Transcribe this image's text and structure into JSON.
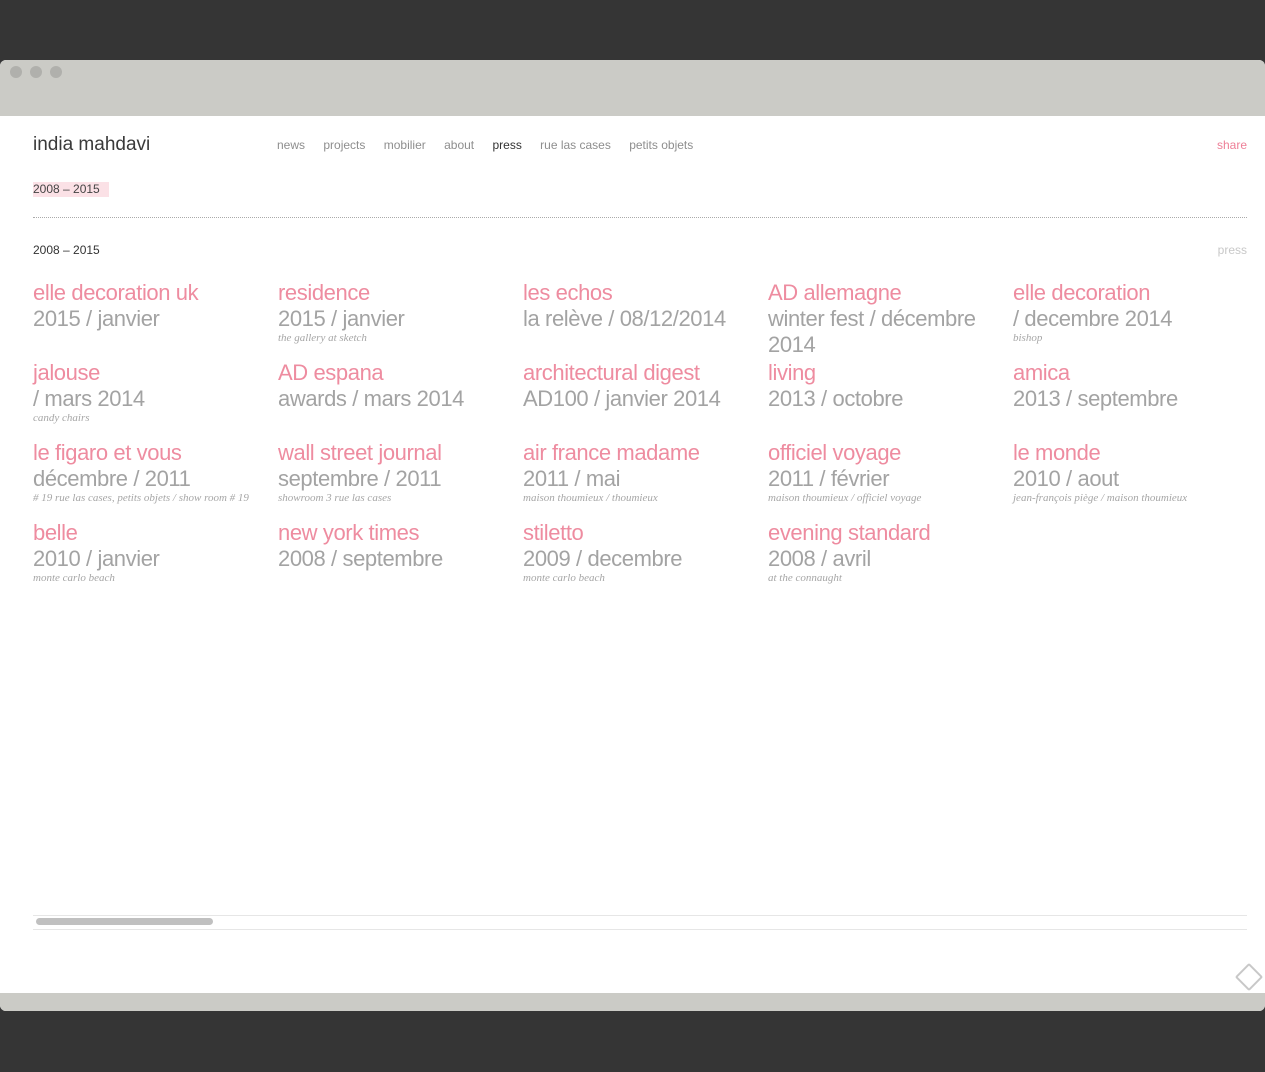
{
  "header": {
    "logo": "india mahdavi",
    "nav": [
      {
        "label": "news"
      },
      {
        "label": "projects"
      },
      {
        "label": "mobilier"
      },
      {
        "label": "about"
      },
      {
        "label": "press",
        "active": true
      },
      {
        "label": "rue las cases"
      },
      {
        "label": "petits objets"
      }
    ],
    "share_label": "share"
  },
  "filter": {
    "active_label": "2008 – 2015"
  },
  "section": {
    "label": "2008 – 2015",
    "right_label": "press"
  },
  "items": [
    {
      "title": "elle decoration uk",
      "sub": "2015 / janvier",
      "note": ""
    },
    {
      "title": "residence",
      "sub": "2015 / janvier",
      "note": "the gallery at sketch"
    },
    {
      "title": "les echos",
      "sub": "la relève / 08/12/2014",
      "note": ""
    },
    {
      "title": "AD allemagne",
      "sub": "winter fest / décembre 2014",
      "note": ""
    },
    {
      "title": "elle decoration",
      "sub": "/ decembre 2014",
      "note": "bishop"
    },
    {
      "title": "jalouse",
      "sub": "/ mars 2014",
      "note": "candy chairs"
    },
    {
      "title": "AD espana",
      "sub": "awards / mars 2014",
      "note": ""
    },
    {
      "title": "architectural digest",
      "sub": "AD100 / janvier 2014",
      "note": ""
    },
    {
      "title": "living",
      "sub": "2013 / octobre",
      "note": ""
    },
    {
      "title": "amica",
      "sub": "2013 / septembre",
      "note": ""
    },
    {
      "title": "le figaro et vous",
      "sub": "décembre / 2011",
      "note": "# 19 rue las cases, petits objets / show room # 19"
    },
    {
      "title": "wall street journal",
      "sub": "septembre / 2011",
      "note": "showroom 3 rue las cases"
    },
    {
      "title": "air france madame",
      "sub": "2011 / mai",
      "note": "maison thoumieux / thoumieux"
    },
    {
      "title": "officiel voyage",
      "sub": "2011 / février",
      "note": "maison thoumieux / officiel voyage"
    },
    {
      "title": "le monde",
      "sub": "2010 / aout",
      "note": "jean-françois piège / maison thoumieux"
    },
    {
      "title": "belle",
      "sub": "2010 / janvier",
      "note": "monte carlo beach"
    },
    {
      "title": "new york times",
      "sub": "2008 / septembre",
      "note": ""
    },
    {
      "title": "stiletto",
      "sub": "2009 / decembre",
      "note": "monte carlo beach"
    },
    {
      "title": "evening standard",
      "sub": "2008 / avril",
      "note": "at the connaught"
    }
  ],
  "icons": {
    "feedback": "feedback-icon"
  },
  "colors": {
    "accent": "#ee8ca0",
    "muted": "#a3a3a3",
    "highlight": "#fbe1e6"
  }
}
